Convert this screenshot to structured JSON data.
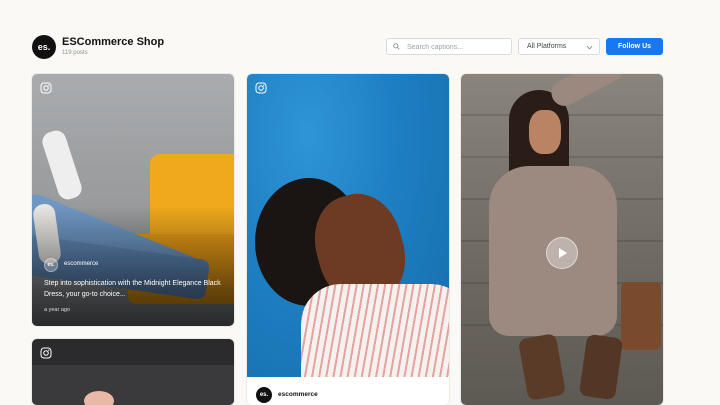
{
  "header": {
    "avatar_text": "es.",
    "title": "ESCommerce Shop",
    "post_count": "119 posts",
    "search_placeholder": "Search captions...",
    "platform_filter": "All Platforms",
    "follow_label": "Follow Us"
  },
  "posts": [
    {
      "platform": "instagram-icon",
      "author_avatar": "es.",
      "author": "escommerce",
      "caption": "Step into sophistication with the Midnight Elegance Black Dress, your go-to choice...",
      "time": "a year ago"
    },
    {
      "platform": "instagram-icon",
      "author_avatar": "es.",
      "author": "escommerce"
    },
    {
      "platform": "video",
      "has_play": true
    },
    {
      "platform": "instagram-icon"
    }
  ],
  "colors": {
    "accent": "#1877f2",
    "background": "#faf9f6"
  }
}
